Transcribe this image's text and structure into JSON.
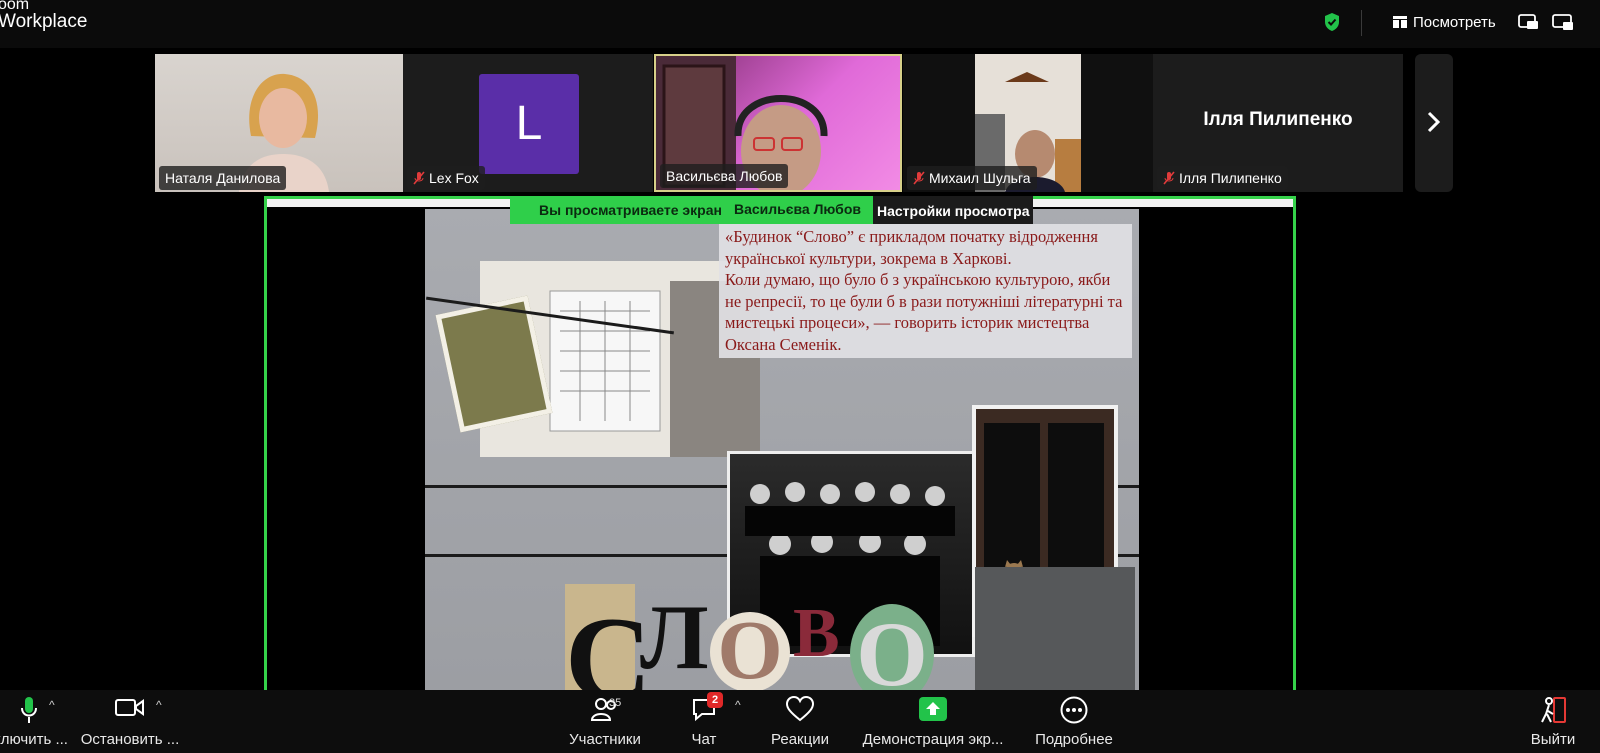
{
  "app": {
    "brand_line1": "oom",
    "brand_line2": "Workplace"
  },
  "topbar": {
    "view_label": "Посмотреть"
  },
  "participants_strip": [
    {
      "name": "Наталя Данилова",
      "muted": false
    },
    {
      "name": "Lex Fox",
      "muted": true,
      "avatar_letter": "L"
    },
    {
      "name": "Васильєва Любов",
      "muted": false,
      "active": true
    },
    {
      "name": "Михаил Шульга",
      "muted": true
    },
    {
      "name": "Ілля Пилипенко",
      "muted": true,
      "display_name": "Ілля Пилипенко"
    }
  ],
  "share": {
    "viewing_label": "Вы просматриваете экран",
    "presenter": "Васильєва Любов",
    "settings_label": "Настройки просмотра"
  },
  "slide": {
    "quote": "«Будинок “Слово” є прикладом початку відродження української культури, зокрема в Харкові.\n   Коли думаю, що було б з українською культурою, якби не репресії, то це були б в рази потужніші літературні та мистецькі процеси», — говорить історик мистецтва Оксана Семенік.",
    "letters": [
      "С",
      "Л",
      "О",
      "В",
      "О"
    ]
  },
  "toolbar": {
    "mic_label": "ключить ...",
    "video_label": "Остановить ...",
    "participants_label": "Участники",
    "participants_count": "35",
    "chat_label": "Чат",
    "chat_badge": "2",
    "reactions_label": "Реакции",
    "share_label": "Демонстрация экр...",
    "more_label": "Подробнее",
    "leave_label": "Выйти"
  },
  "colors": {
    "share_border": "#35d24a",
    "active_tile_border": "#d7d089",
    "quote_text": "#8a1a1a"
  }
}
